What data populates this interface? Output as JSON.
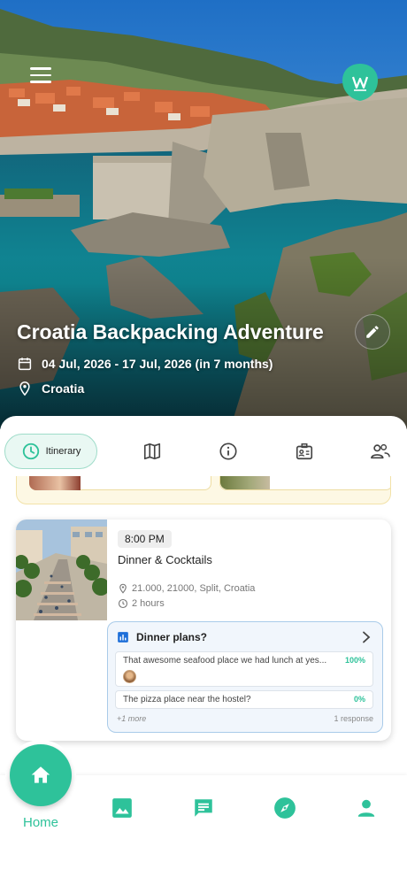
{
  "trip": {
    "title": "Croatia Backpacking Adventure",
    "dates": "04 Jul, 2026 - 17 Jul, 2026 (in 7 months)",
    "location": "Croatia"
  },
  "tabs": [
    {
      "label": "Itinerary",
      "icon": "clock-icon",
      "active": true
    },
    {
      "icon": "map-icon"
    },
    {
      "icon": "info-icon"
    },
    {
      "icon": "id-card-icon"
    },
    {
      "icon": "people-icon"
    }
  ],
  "event": {
    "time": "8:00 PM",
    "title": "Dinner & Cocktails",
    "address": "21.000, 21000, Split, Croatia",
    "duration": "2 hours"
  },
  "poll": {
    "title": "Dinner plans?",
    "options": [
      {
        "text": "That awesome seafood place we had lunch at yes...",
        "percent": "100%"
      },
      {
        "text": "The pizza place near the hostel?",
        "percent": "0%"
      }
    ],
    "more": "+1 more",
    "responses": "1 response"
  },
  "nav": {
    "home_label": "Home",
    "items": [
      "home-icon",
      "gallery-icon",
      "chat-icon",
      "compass-icon",
      "profile-icon"
    ]
  },
  "colors": {
    "accent": "#2ec29a",
    "poll_border": "#a9cbe9",
    "poll_bg": "#f1f6fc"
  }
}
